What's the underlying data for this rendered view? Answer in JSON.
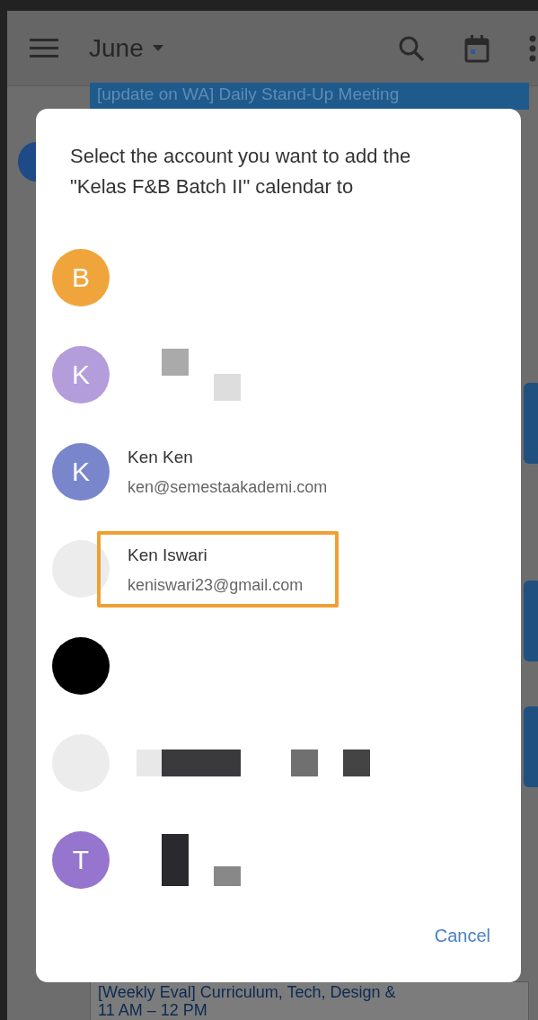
{
  "app_bar": {
    "title": "June"
  },
  "events": [
    {
      "title": "[update on WA] Daily Stand-Up Meeting"
    },
    {
      "title": "[Weekly Eval] Curriculum, Tech, Design &",
      "time": "11 AM – 12 PM"
    }
  ],
  "dialog": {
    "title": "Select the account you want to add the \"Kelas F&B Batch II\" calendar to",
    "accounts": [
      {
        "avatar": {
          "kind": "letter",
          "initial": "B",
          "color": "#f0a53c"
        },
        "redacted": false,
        "highlighted": false
      },
      {
        "avatar": {
          "kind": "letter",
          "initial": "K",
          "color": "#b39ddb"
        },
        "redacted": true,
        "highlighted": false
      },
      {
        "avatar": {
          "kind": "letter",
          "initial": "K",
          "color": "#7986cb"
        },
        "name": "Ken Ken",
        "email": "ken@semestaakademi.com",
        "redacted": false,
        "highlighted": false
      },
      {
        "avatar": {
          "kind": "blank"
        },
        "name": "Ken Iswari",
        "email": "keniswari23@gmail.com",
        "redacted": false,
        "highlighted": true
      },
      {
        "avatar": {
          "kind": "photo"
        },
        "redacted": false,
        "highlighted": false
      },
      {
        "avatar": {
          "kind": "blank"
        },
        "redacted": true,
        "highlighted": false
      },
      {
        "avatar": {
          "kind": "letter",
          "initial": "T",
          "color": "#9575cd"
        },
        "redacted": true,
        "highlighted": false
      }
    ],
    "cancel": "Cancel"
  }
}
